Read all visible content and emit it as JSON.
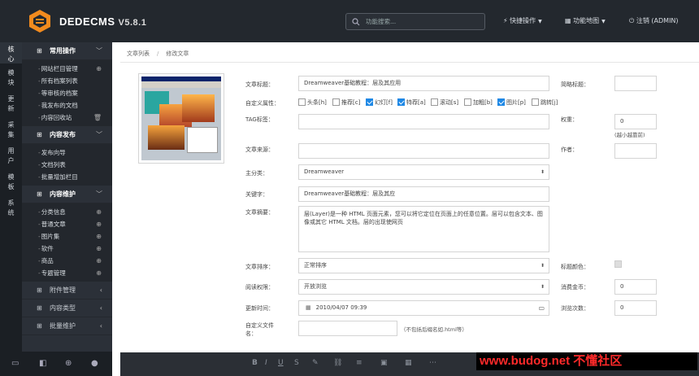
{
  "app": {
    "brand": "DEDECMS",
    "version": "V5.8.1"
  },
  "header": {
    "search_placeholder": "功能搜索...",
    "quick_ops": "快捷操作",
    "site_map": "功能地图",
    "logout": "注销 (ADMIN)"
  },
  "icon_rail": [
    "核心",
    "模块",
    "更新",
    "采集",
    "用户",
    "模板",
    "系统"
  ],
  "sidebar": {
    "groups": [
      {
        "label": "常用操作",
        "items": [
          "网站栏目管理",
          "所有档案列表",
          "等审核的档案",
          "我发布的文档",
          "内容回收站"
        ]
      },
      {
        "label": "内容发布",
        "items": [
          "发布向导",
          "文档列表",
          "批量增加栏目"
        ]
      },
      {
        "label": "内容维护",
        "items": [
          "分类信息",
          "普通文章",
          "图片集",
          "软件",
          "商品",
          "专题管理"
        ]
      },
      {
        "label": "附件管理"
      },
      {
        "label": "内容类型"
      },
      {
        "label": "批量维护"
      }
    ]
  },
  "breadcrumb": {
    "parent": "文章列表",
    "current": "修改文章"
  },
  "form": {
    "title_label": "文章标题：",
    "title_value": "Dreamweaver基础教程：层及其应用",
    "short_title_label": "简略标题：",
    "attr_label": "自定义属性：",
    "attrs": [
      {
        "label": "头条[h]",
        "checked": false
      },
      {
        "label": "推荐[c]",
        "checked": false
      },
      {
        "label": "幻灯[f]",
        "checked": true
      },
      {
        "label": "特荐[a]",
        "checked": true
      },
      {
        "label": "滚动[s]",
        "checked": false
      },
      {
        "label": "加粗[b]",
        "checked": false
      },
      {
        "label": "图片[p]",
        "checked": true
      },
      {
        "label": "跳转[j]",
        "checked": false
      }
    ],
    "tag_label": "TAG标签：",
    "weight_label": "权重：",
    "weight_value": "0",
    "weight_hint": "(越小越靠前)",
    "source_label": "文章来源：",
    "author_label": "作者：",
    "category_label": "主分类：",
    "category_value": "Dreamweaver",
    "keywords_label": "关键字：",
    "keywords_value": "Dreamweaver基础教程：层及其应",
    "summary_label": "文章摘要：",
    "summary_value": "层(Layer)是一种 HTML 页面元素，您可以将它定位在页面上的任意位置。层可以包含文本、图像或其它 HTML 文档。层的出现使网页",
    "sort_label": "文章排序：",
    "sort_value": "正常排序",
    "title_color_label": "标题颜色：",
    "read_perm_label": "阅读权限：",
    "read_perm_value": "开放浏览",
    "coins_label": "消费金币：",
    "coins_value": "0",
    "update_label": "更新时间：",
    "update_value": "2010/04/07 09:39",
    "views_label": "浏览次数：",
    "views_value": "0",
    "filename_label": "自定义文件名：",
    "filename_hint": "（不包括后缀名如.html等）"
  },
  "watermark": "www.budog.net 不懂社区"
}
